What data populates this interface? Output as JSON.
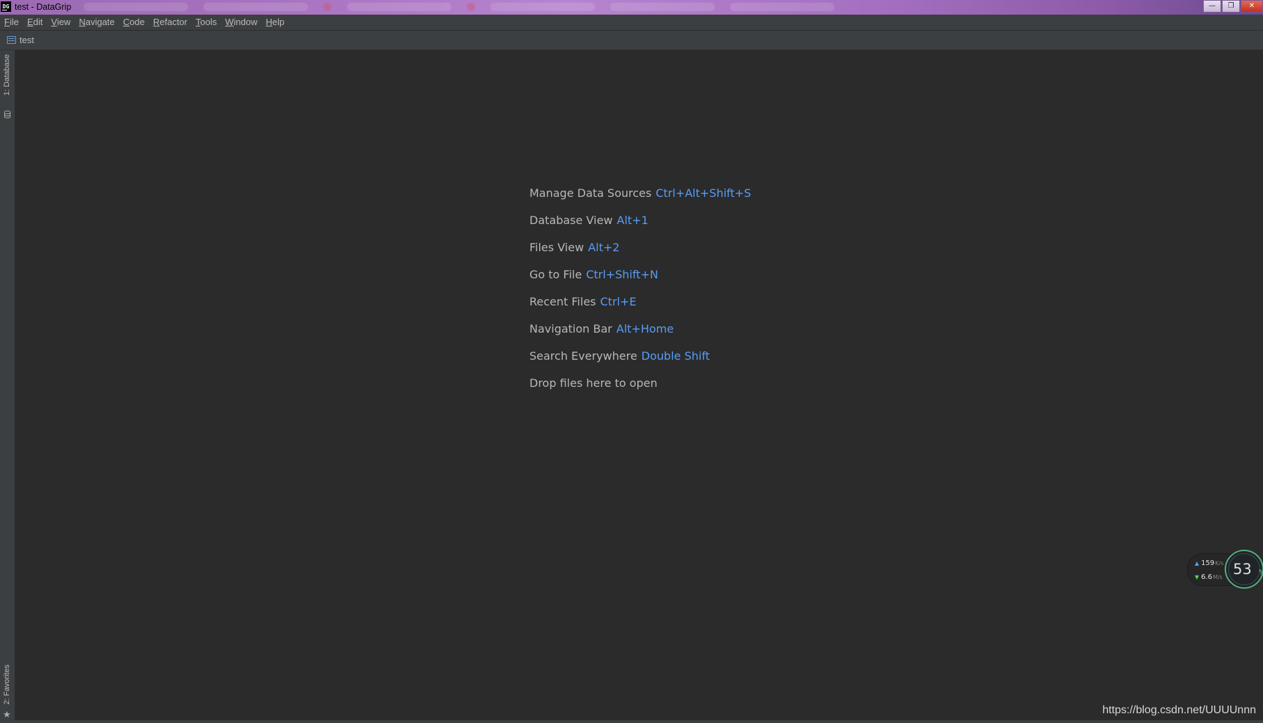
{
  "window": {
    "app_icon_text": "DG",
    "title": "test - DataGrip",
    "controls": {
      "minimize_icon": "minimize-icon",
      "maximize_icon": "restore-icon",
      "close_icon": "close-icon"
    }
  },
  "menubar": {
    "items": [
      {
        "mnemonic": "F",
        "rest": "ile"
      },
      {
        "mnemonic": "E",
        "rest": "dit"
      },
      {
        "mnemonic": "V",
        "rest": "iew"
      },
      {
        "mnemonic": "N",
        "rest": "avigate"
      },
      {
        "mnemonic": "C",
        "rest": "ode"
      },
      {
        "mnemonic": "R",
        "rest": "efactor"
      },
      {
        "mnemonic": "T",
        "rest": "ools"
      },
      {
        "mnemonic": "W",
        "rest": "indow"
      },
      {
        "mnemonic": "H",
        "rest": "elp"
      }
    ]
  },
  "navbar": {
    "project": "test",
    "icon": "database-console-icon"
  },
  "left_strip": {
    "database_tab": "1: Database",
    "favorites_tab": "2: Favorites"
  },
  "editor": {
    "hints": [
      {
        "label": "Manage Data Sources",
        "shortcut": "Ctrl+Alt+Shift+S"
      },
      {
        "label": "Database View",
        "shortcut": "Alt+1"
      },
      {
        "label": "Files View",
        "shortcut": "Alt+2"
      },
      {
        "label": "Go to File",
        "shortcut": "Ctrl+Shift+N"
      },
      {
        "label": "Recent Files",
        "shortcut": "Ctrl+E"
      },
      {
        "label": "Navigation Bar",
        "shortcut": "Alt+Home"
      },
      {
        "label": "Search Everywhere",
        "shortcut": "Double Shift"
      },
      {
        "label": "Drop files here to open",
        "shortcut": ""
      }
    ]
  },
  "net_monitor": {
    "upload": "159",
    "upload_unit": "K/s",
    "download": "6.6",
    "download_unit": "M/s",
    "percent": "53",
    "percent_sign": "%"
  },
  "watermark": "https://blog.csdn.net/UUUUnnn",
  "colors": {
    "background": "#2b2b2b",
    "chrome": "#3c3f41",
    "text": "#bbbbbb",
    "shortcut": "#589df6"
  }
}
